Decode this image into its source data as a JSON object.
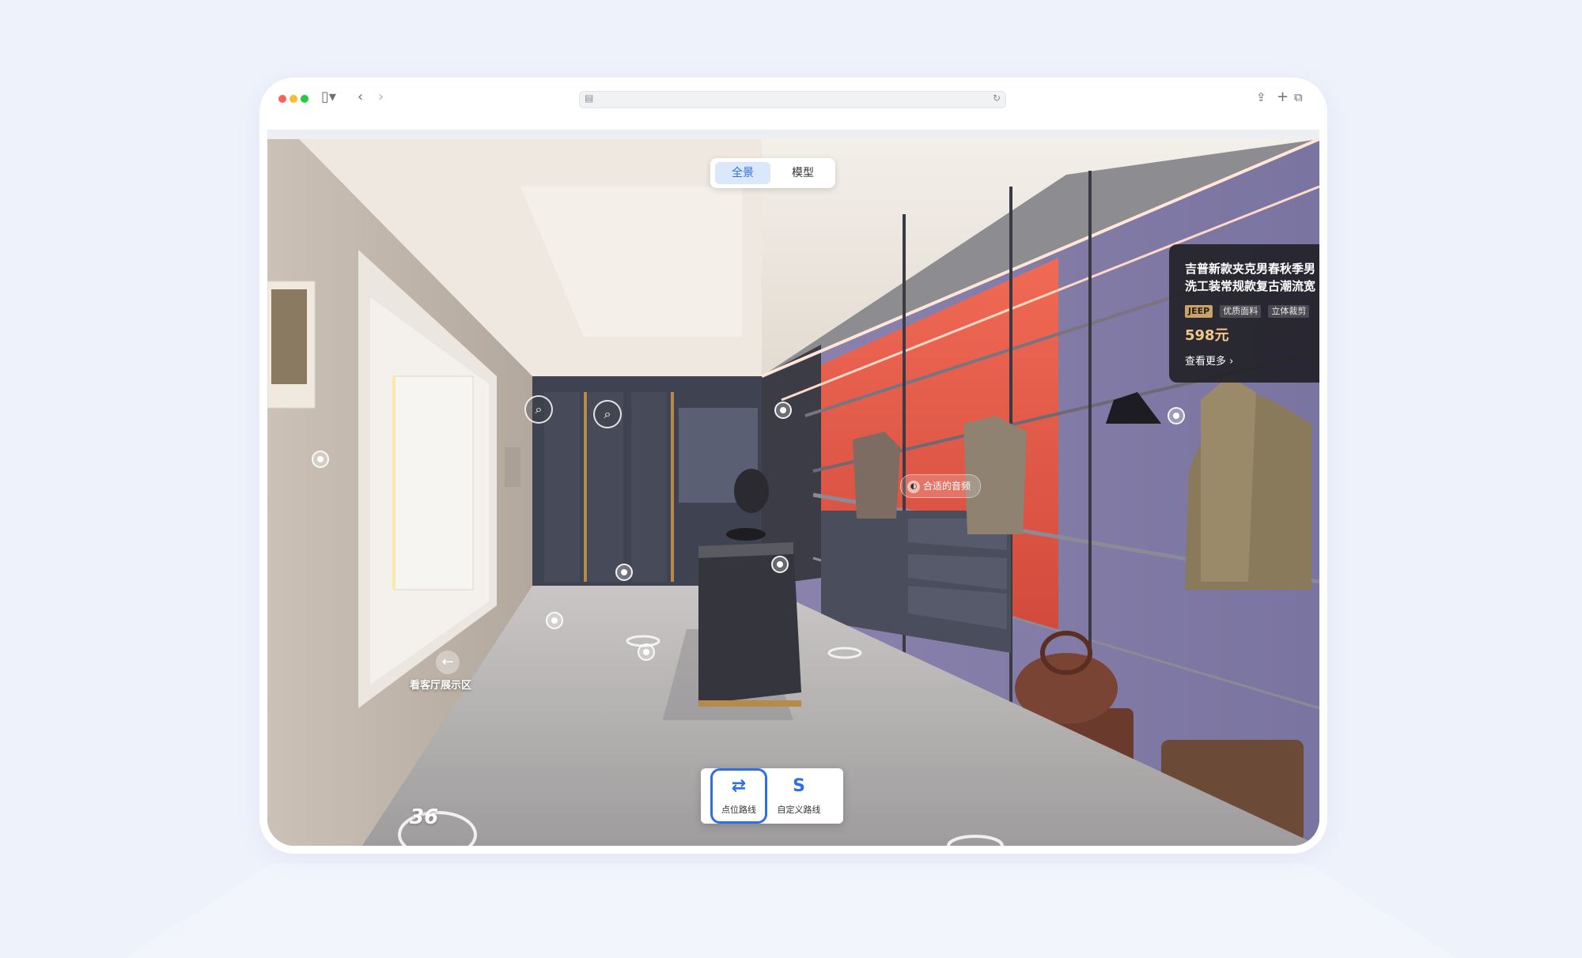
{
  "browser": {
    "sidebar_icon": "sidebar-icon",
    "back_icon": "back-icon",
    "forward_icon": "forward-icon",
    "share_icon": "share-icon",
    "new_tab_icon": "plus-icon",
    "tabs_icon": "tabs-overview-icon"
  },
  "viewer": {
    "modes": [
      "全景",
      "模型"
    ],
    "active_mode": "全景",
    "product": {
      "title_line1": "吉普新款夹克男春秋季男",
      "title_line2": "洗工装常规款复古潮流宽",
      "tags": [
        "JEEP",
        "优质面料",
        "立体裁剪"
      ],
      "price": "598元",
      "more": "查看更多"
    },
    "audio_label": "合适的音频",
    "nav_label": "看客厅展示区",
    "badge": "36",
    "routes": [
      {
        "label": "点位路线",
        "icon": "route-icon",
        "active": true
      },
      {
        "label": "自定义路线",
        "icon": "custom-route-icon",
        "active": false
      }
    ]
  },
  "colors": {
    "accent": "#2f6fe0",
    "price": "#f2c78a",
    "wall_red": "#e2574a",
    "wall_purple": "#8c86b0"
  }
}
